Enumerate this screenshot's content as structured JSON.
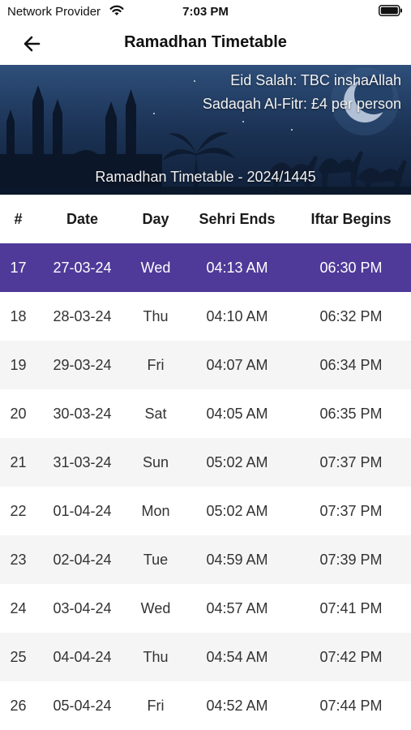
{
  "status": {
    "carrier": "Network Provider",
    "time": "7:03 PM"
  },
  "nav": {
    "title": "Ramadhan Timetable"
  },
  "banner": {
    "eid": "Eid Salah: TBC inshaAllah",
    "sadaqah": "Sadaqah Al-Fitr: £4 per person",
    "caption": "Ramadhan Timetable - 2024/1445"
  },
  "table": {
    "headers": {
      "num": "#",
      "date": "Date",
      "day": "Day",
      "sehri": "Sehri Ends",
      "iftar": "Iftar Begins"
    },
    "rows": [
      {
        "num": "17",
        "date": "27-03-24",
        "day": "Wed",
        "sehri": "04:13 AM",
        "iftar": "06:30 PM"
      },
      {
        "num": "18",
        "date": "28-03-24",
        "day": "Thu",
        "sehri": "04:10 AM",
        "iftar": "06:32 PM"
      },
      {
        "num": "19",
        "date": "29-03-24",
        "day": "Fri",
        "sehri": "04:07 AM",
        "iftar": "06:34 PM"
      },
      {
        "num": "20",
        "date": "30-03-24",
        "day": "Sat",
        "sehri": "04:05 AM",
        "iftar": "06:35 PM"
      },
      {
        "num": "21",
        "date": "31-03-24",
        "day": "Sun",
        "sehri": "05:02 AM",
        "iftar": "07:37 PM"
      },
      {
        "num": "22",
        "date": "01-04-24",
        "day": "Mon",
        "sehri": "05:02 AM",
        "iftar": "07:37 PM"
      },
      {
        "num": "23",
        "date": "02-04-24",
        "day": "Tue",
        "sehri": "04:59 AM",
        "iftar": "07:39 PM"
      },
      {
        "num": "24",
        "date": "03-04-24",
        "day": "Wed",
        "sehri": "04:57 AM",
        "iftar": "07:41 PM"
      },
      {
        "num": "25",
        "date": "04-04-24",
        "day": "Thu",
        "sehri": "04:54 AM",
        "iftar": "07:42 PM"
      },
      {
        "num": "26",
        "date": "05-04-24",
        "day": "Fri",
        "sehri": "04:52 AM",
        "iftar": "07:44 PM"
      }
    ],
    "highlight_color": "#4f3a99",
    "alt_row_color": "#f5f5f5"
  }
}
